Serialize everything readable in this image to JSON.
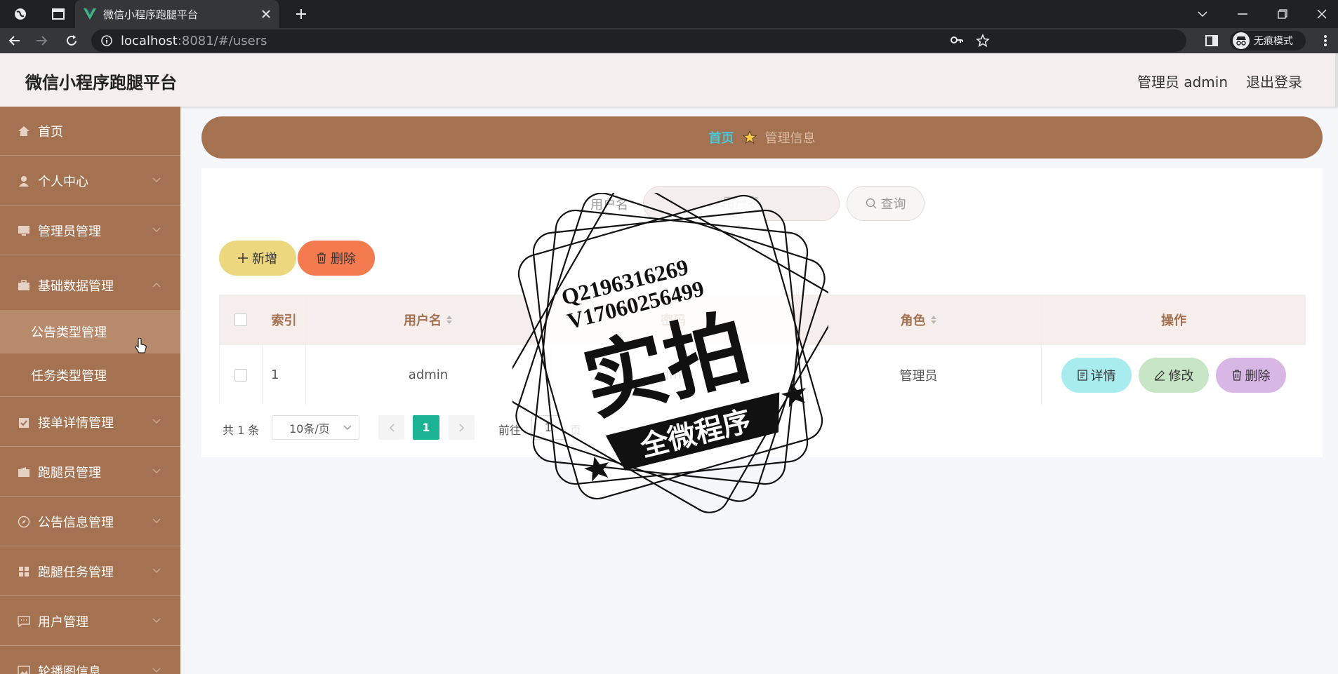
{
  "browser": {
    "tab_title": "微信小程序跑腿平台",
    "url_host": "localhost",
    "url_rest": ":8081/#/users",
    "incognito_label": "无痕模式"
  },
  "header": {
    "title": "微信小程序跑腿平台",
    "user": "管理员 admin",
    "logout": "退出登录"
  },
  "sidebar": {
    "items": [
      {
        "label": "首页",
        "icon": "home-icon"
      },
      {
        "label": "个人中心",
        "icon": "user-icon"
      },
      {
        "label": "管理员管理",
        "icon": "monitor-icon"
      },
      {
        "label": "基础数据管理",
        "icon": "briefcase-icon"
      },
      {
        "label": "接单详情管理",
        "icon": "clipboard-icon"
      },
      {
        "label": "跑腿员管理",
        "icon": "wallet-icon"
      },
      {
        "label": "公告信息管理",
        "icon": "compass-icon"
      },
      {
        "label": "跑腿任务管理",
        "icon": "grid-icon"
      },
      {
        "label": "用户管理",
        "icon": "chat-icon"
      },
      {
        "label": "轮播图信息",
        "icon": "picture-icon"
      }
    ],
    "submenu": [
      {
        "label": "公告类型管理"
      },
      {
        "label": "任务类型管理"
      }
    ]
  },
  "breadcrumb": {
    "home": "首页",
    "current": "管理信息"
  },
  "search": {
    "label": "用户名",
    "placeholder": "用户名",
    "button": "查询"
  },
  "toolbar": {
    "add": "新增",
    "delete": "删除"
  },
  "table": {
    "columns": [
      "索引",
      "用户名",
      "密码",
      "角色",
      "操作"
    ],
    "rows": [
      {
        "index": "1",
        "username": "admin",
        "password": "admin",
        "role": "管理员"
      }
    ],
    "actions": {
      "detail": "详情",
      "edit": "修改",
      "delete": "删除"
    }
  },
  "pagination": {
    "total": "共 1 条",
    "page_size": "10条/页",
    "current_page": "1",
    "goto_label": "前往",
    "goto_value": "1",
    "page_suffix": "页"
  },
  "watermark": {
    "line1": "Q2196316269",
    "line2": "V17060256499",
    "main": "实拍",
    "banner": "全微程序"
  },
  "colors": {
    "sidebar": "#a47251",
    "accent_teal": "#1ab394",
    "add_button": "#ecd77e",
    "delete_button": "#f47b50"
  }
}
